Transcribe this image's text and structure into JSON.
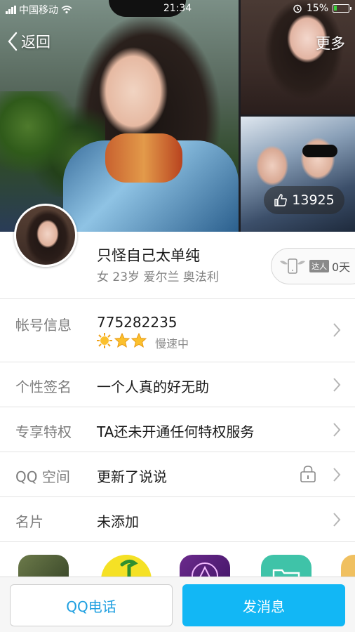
{
  "status_bar": {
    "carrier": "中国移动",
    "time": "21:34",
    "battery": "15%"
  },
  "nav": {
    "back_label": "返回",
    "more_label": "更多"
  },
  "photos": {
    "likes": "13925"
  },
  "profile": {
    "nickname": "只怪自己太单纯",
    "info": "女 23岁 爱尔兰 奥法利",
    "expert_tag": "达人",
    "expert_days": "0天"
  },
  "rows": {
    "account": {
      "label": "帐号信息",
      "value": "775282235",
      "speed": "慢速中"
    },
    "signature": {
      "label": "个性签名",
      "value": "一个人真的好无助"
    },
    "privilege": {
      "label": "专享特权",
      "value": "TA还未开通任何特权服务"
    },
    "zone": {
      "label": "QQ 空间",
      "value": "更新了说说"
    },
    "card": {
      "label": "名片",
      "value": "未添加"
    }
  },
  "actions": {
    "call_label": "QQ电话",
    "message_label": "发消息"
  },
  "colors": {
    "accent": "#12b7f5",
    "call_text": "#1e9fe0",
    "label_gray": "#7d7d7d"
  }
}
